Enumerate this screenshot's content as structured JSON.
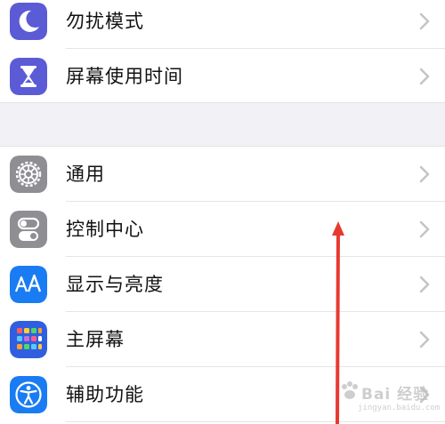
{
  "groups": [
    {
      "items": [
        {
          "label": "勿扰模式",
          "icon": "moon-icon",
          "color": "#5b5bd6"
        },
        {
          "label": "屏幕使用时间",
          "icon": "hourglass-icon",
          "color": "#5b5bd6"
        }
      ]
    },
    {
      "items": [
        {
          "label": "通用",
          "icon": "gear-icon",
          "color": "#8e8e93"
        },
        {
          "label": "控制中心",
          "icon": "toggle-switches-icon",
          "color": "#8e8e93"
        },
        {
          "label": "显示与亮度",
          "icon": "text-size-aa-icon",
          "color": "#1a7cf2"
        },
        {
          "label": "主屏幕",
          "icon": "app-grid-icon",
          "color": "#2f5fe0"
        },
        {
          "label": "辅助功能",
          "icon": "accessibility-person-icon",
          "color": "#1a7cf2"
        }
      ]
    }
  ],
  "annotation": {
    "arrow_color": "#e8392f"
  },
  "watermark": {
    "text": "Bai 经验",
    "url": "jingyan.baidu.com"
  }
}
